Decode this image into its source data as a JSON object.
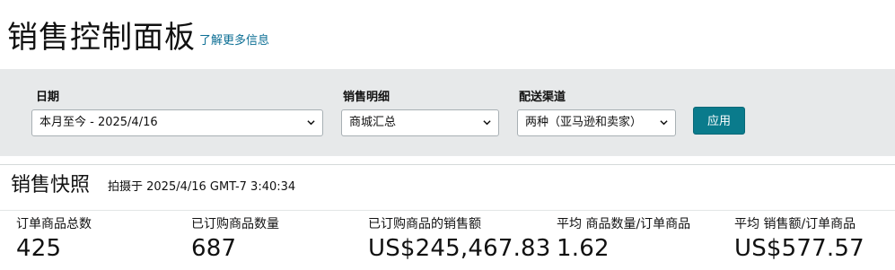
{
  "header": {
    "title": "销售控制面板",
    "learn_more": "了解更多信息"
  },
  "filters": {
    "date": {
      "label": "日期",
      "value": "本月至今 - 2025/4/16"
    },
    "sales_breakdown": {
      "label": "销售明细",
      "value": "商城汇总"
    },
    "fulfillment": {
      "label": "配送渠道",
      "value": "两种（亚马逊和卖家）"
    },
    "apply_label": "应用"
  },
  "snapshot": {
    "title": "销售快照",
    "timestamp": "拍摄于 2025/4/16 GMT-7 3:40:34",
    "metrics": [
      {
        "label": "订单商品总数",
        "value": "425"
      },
      {
        "label": "已订购商品数量",
        "value": "687"
      },
      {
        "label": "已订购商品的销售额",
        "value": "US$245,467.83"
      },
      {
        "label": "平均 商品数量/订单商品",
        "value": "1.62"
      },
      {
        "label": "平均 销售额/订单商品",
        "value": "US$577.57"
      }
    ]
  },
  "colors": {
    "accent": "#0a7b8c",
    "link": "#0b6e94",
    "filter_bar_bg": "#e7e9ea"
  },
  "icons": [
    "chevron-down-icon"
  ]
}
